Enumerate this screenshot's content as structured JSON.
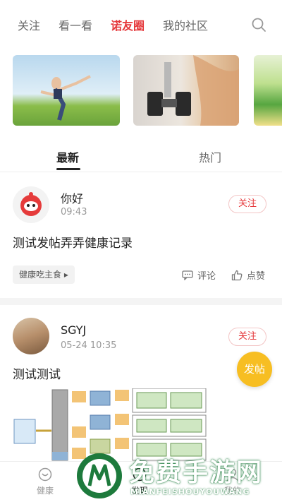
{
  "top_tabs": [
    {
      "label": "关注",
      "active": false
    },
    {
      "label": "看一看",
      "active": false
    },
    {
      "label": "诺友圈",
      "active": true
    },
    {
      "label": "我的社区",
      "active": false
    }
  ],
  "sub_tabs": {
    "latest": "最新",
    "hot": "热门"
  },
  "posts": [
    {
      "author": "你好",
      "time": "09:43",
      "follow": "关注",
      "content": "测试发帖弄弄健康记录",
      "tag": "健康吃主食",
      "comment": "评论",
      "like": "点赞"
    },
    {
      "author": "SGYJ",
      "time": "05-24 10:35",
      "follow": "关注",
      "content": "测试测试"
    }
  ],
  "fab": "发帖",
  "bottom_nav": {
    "health": "健康",
    "discover": "发现",
    "mine": "我的"
  },
  "watermark": {
    "text": "免费手游网",
    "sub": "MIANFEISHOUYOUWANG"
  },
  "colors": {
    "accent": "#e5373a",
    "fab": "#f7be22",
    "watermark_green": "#1d7a3c"
  }
}
